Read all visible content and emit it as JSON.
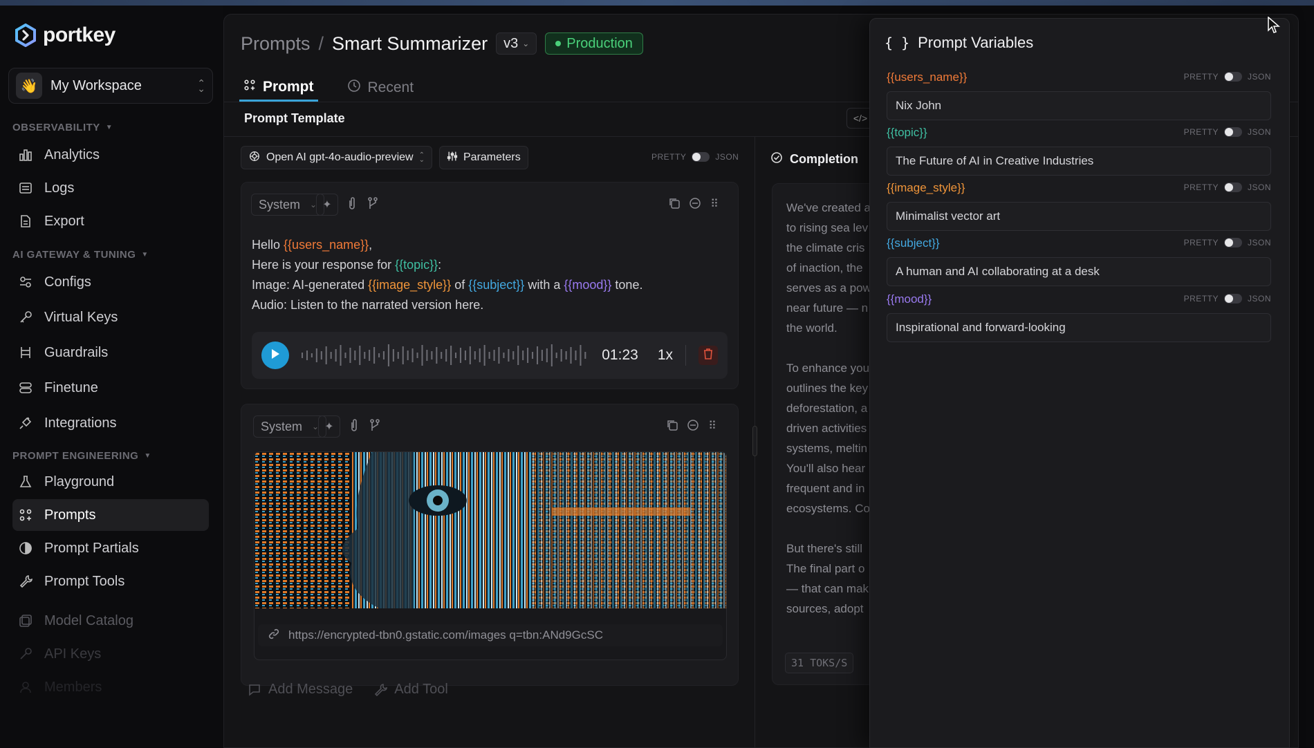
{
  "brand": {
    "name": "portkey"
  },
  "workspace": {
    "name": "My Workspace",
    "emoji": "👋"
  },
  "sidebar": {
    "sections": [
      {
        "label": "OBSERVABILITY"
      },
      {
        "label": "AI GATEWAY & TUNING"
      },
      {
        "label": "PROMPT ENGINEERING"
      }
    ],
    "items": [
      {
        "label": "Analytics",
        "icon": "bar-chart-icon"
      },
      {
        "label": "Logs",
        "icon": "list-icon"
      },
      {
        "label": "Export",
        "icon": "file-export-icon"
      },
      {
        "label": "Configs",
        "icon": "sliders-icon"
      },
      {
        "label": "Virtual Keys",
        "icon": "key-icon"
      },
      {
        "label": "Guardrails",
        "icon": "guardrail-icon"
      },
      {
        "label": "Finetune",
        "icon": "layers-icon"
      },
      {
        "label": "Integrations",
        "icon": "plug-icon"
      },
      {
        "label": "Playground",
        "icon": "flask-icon"
      },
      {
        "label": "Prompts",
        "icon": "prompts-icon"
      },
      {
        "label": "Prompt Partials",
        "icon": "half-circle-icon"
      },
      {
        "label": "Prompt Tools",
        "icon": "wrench-icon"
      },
      {
        "label": "Model Catalog",
        "icon": "catalog-icon"
      },
      {
        "label": "API Keys",
        "icon": "key-icon"
      },
      {
        "label": "Members",
        "icon": "members-icon"
      }
    ]
  },
  "header": {
    "breadcrumb_root": "Prompts",
    "separator": "/",
    "prompt_name": "Smart Summarizer",
    "version": "v3",
    "status": "Production"
  },
  "tabs": [
    {
      "label": "Prompt"
    },
    {
      "label": "Recent"
    }
  ],
  "template": {
    "title": "Prompt Template",
    "model": "Open AI gpt-4o-audio-preview",
    "params_label": "Parameters",
    "toggle_left": "PRETTY",
    "toggle_right": "JSON"
  },
  "message1": {
    "role": "System",
    "line1_pre": "Hello ",
    "line1_var": "{{users_name}}",
    "line1_post": ",",
    "line2_pre": "Here is your response for ",
    "line2_var": "{{topic}}",
    "line2_post": ":",
    "line3_a": "Image: AI-generated ",
    "line3_var1": "{{image_style}}",
    "line3_b": " of ",
    "line3_var2": "{{subject}}",
    "line3_c": " with a ",
    "line3_var3": "{{mood}}",
    "line3_d": " tone.",
    "line4": "Audio: Listen to the narrated version here.",
    "audio_time": "01:23",
    "audio_speed": "1x"
  },
  "message2": {
    "role": "System",
    "image_url": "https://encrypted-tbn0.gstatic.com/images q=tbn:ANd9GcSC"
  },
  "actions": {
    "add_message": "Add Message",
    "add_tool": "Add Tool"
  },
  "completion": {
    "title": "Completion",
    "lines": [
      "We've created a",
      "to rising sea lev",
      "the climate cris",
      "of inaction, the",
      "serves as a pow",
      "near future — n",
      "the world.",
      "",
      "To enhance you",
      "outlines the key",
      "deforestation, a",
      "driven activities",
      "systems, meltin",
      "You'll also hear",
      "frequent and in",
      "ecosystems. Co",
      "",
      "But there's still",
      "The final part o",
      "— that can mak",
      "sources, adopt"
    ],
    "tokens": "31 TOKS/S"
  },
  "variables_panel": {
    "title": "Prompt Variables",
    "toggle_left": "PRETTY",
    "toggle_right": "JSON",
    "vars": [
      {
        "name": "{{users_name}}",
        "value": "Nix John",
        "color": "#f07a38"
      },
      {
        "name": "{{topic}}",
        "value": "The Future of AI in Creative Industries",
        "color": "#3fbfa2"
      },
      {
        "name": "{{image_style}}",
        "value": "Minimalist vector art",
        "color": "#f0953a"
      },
      {
        "name": "{{subject}}",
        "value": "A human and AI collaborating at a desk",
        "color": "#43a8e0"
      },
      {
        "name": "{{mood}}",
        "value": "Inspirational and forward-looking",
        "color": "#9a7af0"
      }
    ]
  },
  "colors": {
    "accent": "#1f9bd6",
    "production": "#4ad07a",
    "background": "#0b0b0d"
  }
}
